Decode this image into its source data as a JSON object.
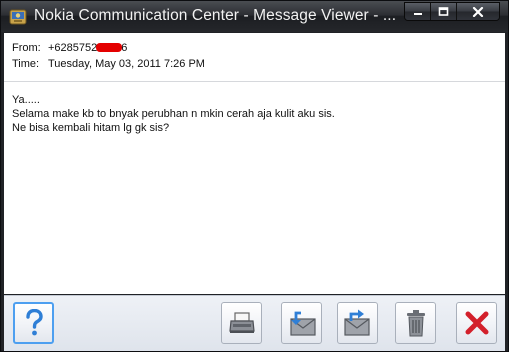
{
  "window": {
    "title": "Nokia Communication Center - Message Viewer - ..."
  },
  "header": {
    "from_label": "From:",
    "from_prefix": "+6285752",
    "from_suffix": "6",
    "time_label": "Time:",
    "time_value": "Tuesday, May 03, 2011 7:26 PM"
  },
  "message": {
    "lines": [
      "Ya.....",
      "Selama make kb to bnyak perubhan n mkin cerah aja kulit aku sis.",
      "Ne bisa kembali hitam lg gk sis?"
    ]
  },
  "toolbar": {
    "help_icon": "question-mark-icon",
    "print_icon": "printer-icon",
    "reply_icon": "reply-envelope-icon",
    "forward_icon": "forward-envelope-icon",
    "delete_icon": "trash-icon",
    "close_icon": "red-x-icon"
  },
  "colors": {
    "help_accent": "#4d9ff0",
    "close_red": "#d3202b",
    "redaction": "#e40000"
  }
}
